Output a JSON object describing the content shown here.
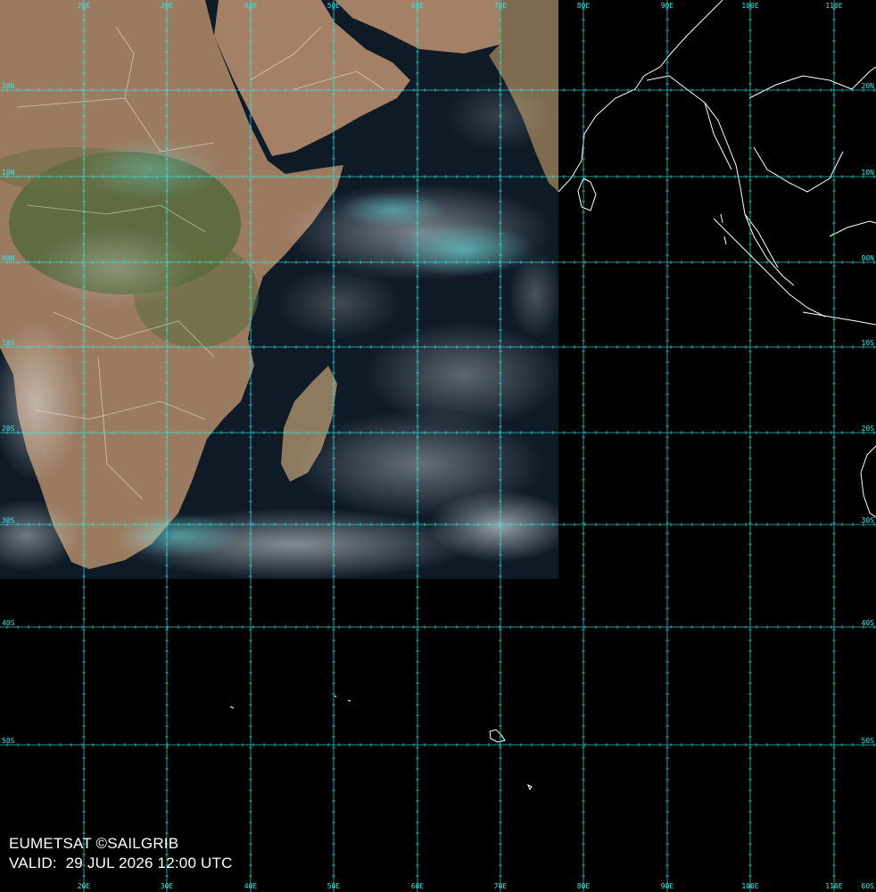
{
  "map": {
    "lon_labels": [
      "20E",
      "30E",
      "40E",
      "50E",
      "60E",
      "70E",
      "80E",
      "90E",
      "100E",
      "110E"
    ],
    "lat_labels": [
      "20N",
      "10N",
      "00N",
      "10S",
      "20S",
      "30S",
      "40S",
      "50S"
    ],
    "corner_label": "60S",
    "colors": {
      "grid": "#37e6e6",
      "ocean": "#0e1a26",
      "land": "#9c7a5e",
      "vegetation": "#52663a",
      "cloud": "#d9e4ea",
      "cloud_cyan": "#5ff0f0",
      "coast": "#ffffff",
      "background": "#000000"
    }
  },
  "caption": {
    "credit": "EUMETSAT ©SAILGRIB",
    "valid_label": "VALID:",
    "valid_time": "29 JUL 2026 12:00 UTC"
  }
}
